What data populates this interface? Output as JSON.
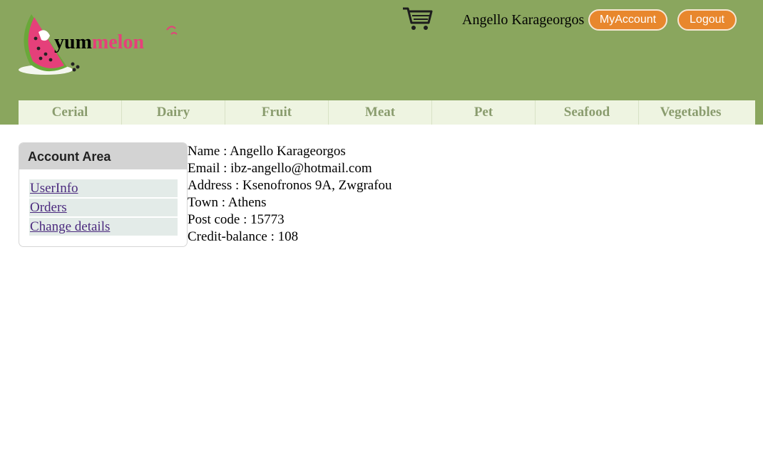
{
  "header": {
    "brand": {
      "part1": "yum",
      "part2": "melon"
    },
    "user_name": "Angello Karageorgos",
    "my_account_label": "MyAccount",
    "logout_label": "Logout",
    "colors": {
      "background": "#8aa65e",
      "button": "#e8872d",
      "brand_pink": "#e5407a"
    }
  },
  "nav": {
    "items": [
      "Cerial",
      "Dairy",
      "Fruit",
      "Meat",
      "Pet",
      "Seafood",
      "Vegetables"
    ]
  },
  "sidebar": {
    "title": "Account Area",
    "links": [
      "UserInfo",
      "Orders",
      "Change details"
    ]
  },
  "user_info": {
    "lines": [
      "Name : Angello Karageorgos",
      "Email : ibz-angello@hotmail.com",
      "Address : Ksenofronos 9A, Zwgrafou",
      "Town : Athens",
      "Post code : 15773",
      "Credit-balance : 108"
    ]
  }
}
